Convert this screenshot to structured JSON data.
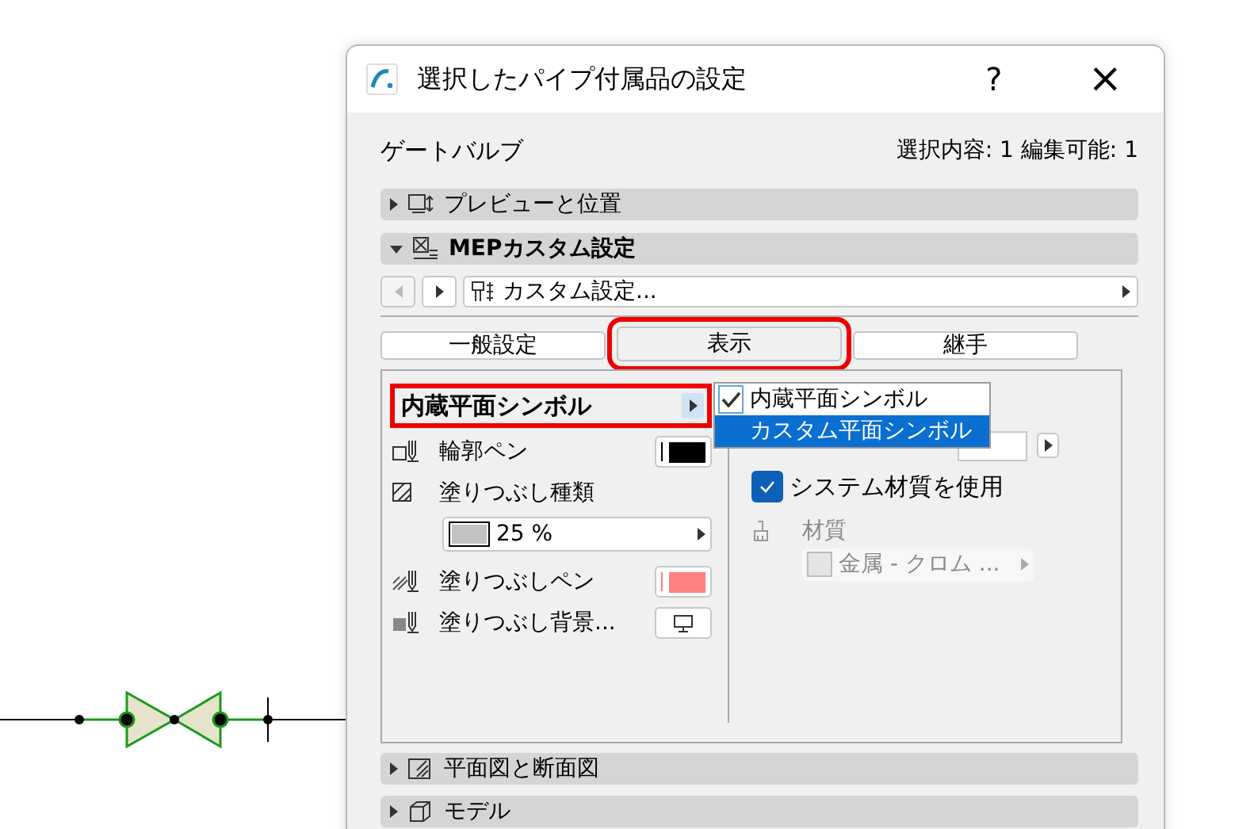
{
  "window": {
    "title": "選択したパイプ付属品の設定",
    "help": "?",
    "close": "×"
  },
  "header": {
    "element_name": "ゲートバルブ",
    "selection_info": "選択内容: 1 編集可能: 1"
  },
  "sections_top": [
    {
      "label": "プレビューと位置",
      "expanded": false,
      "kind": "preview"
    },
    {
      "label": "MEPカスタム設定",
      "expanded": true,
      "kind": "custom"
    }
  ],
  "custom_nav": {
    "value": "カスタム設定..."
  },
  "tabs": [
    {
      "label": "一般設定",
      "selected": false,
      "highlighted": false
    },
    {
      "label": "表示",
      "selected": true,
      "highlighted": true
    },
    {
      "label": "継手",
      "selected": false,
      "highlighted": false
    }
  ],
  "symbol_dropdown": {
    "value": "内蔵平面シンボル",
    "highlighted": true
  },
  "left_rows": [
    {
      "kind": "contour_pen",
      "label": "輪郭ペン",
      "color": "#000000"
    },
    {
      "kind": "fill_type",
      "label": "塗りつぶし種類"
    },
    {
      "kind": "fill_pattern",
      "value": "25 %"
    },
    {
      "kind": "fill_pen",
      "label": "塗りつぶしペン",
      "color": "#ff8080"
    },
    {
      "kind": "fill_background",
      "label": "塗りつぶし背景..."
    }
  ],
  "popup_menu": [
    {
      "label": "内蔵平面シンボル",
      "checked": true,
      "selected": false
    },
    {
      "label": "カスタム平面シンボル",
      "checked": false,
      "selected": true
    }
  ],
  "use_system_material": {
    "label": "システム材質を使用",
    "checked": true
  },
  "material": {
    "label": "材質",
    "value": "金属 - クロム ...",
    "disabled": true
  },
  "sections_bottom": [
    {
      "label": "平面図と断面図",
      "expanded": false,
      "kind": "plan"
    },
    {
      "label": "モデル",
      "expanded": false,
      "kind": "model"
    }
  ]
}
